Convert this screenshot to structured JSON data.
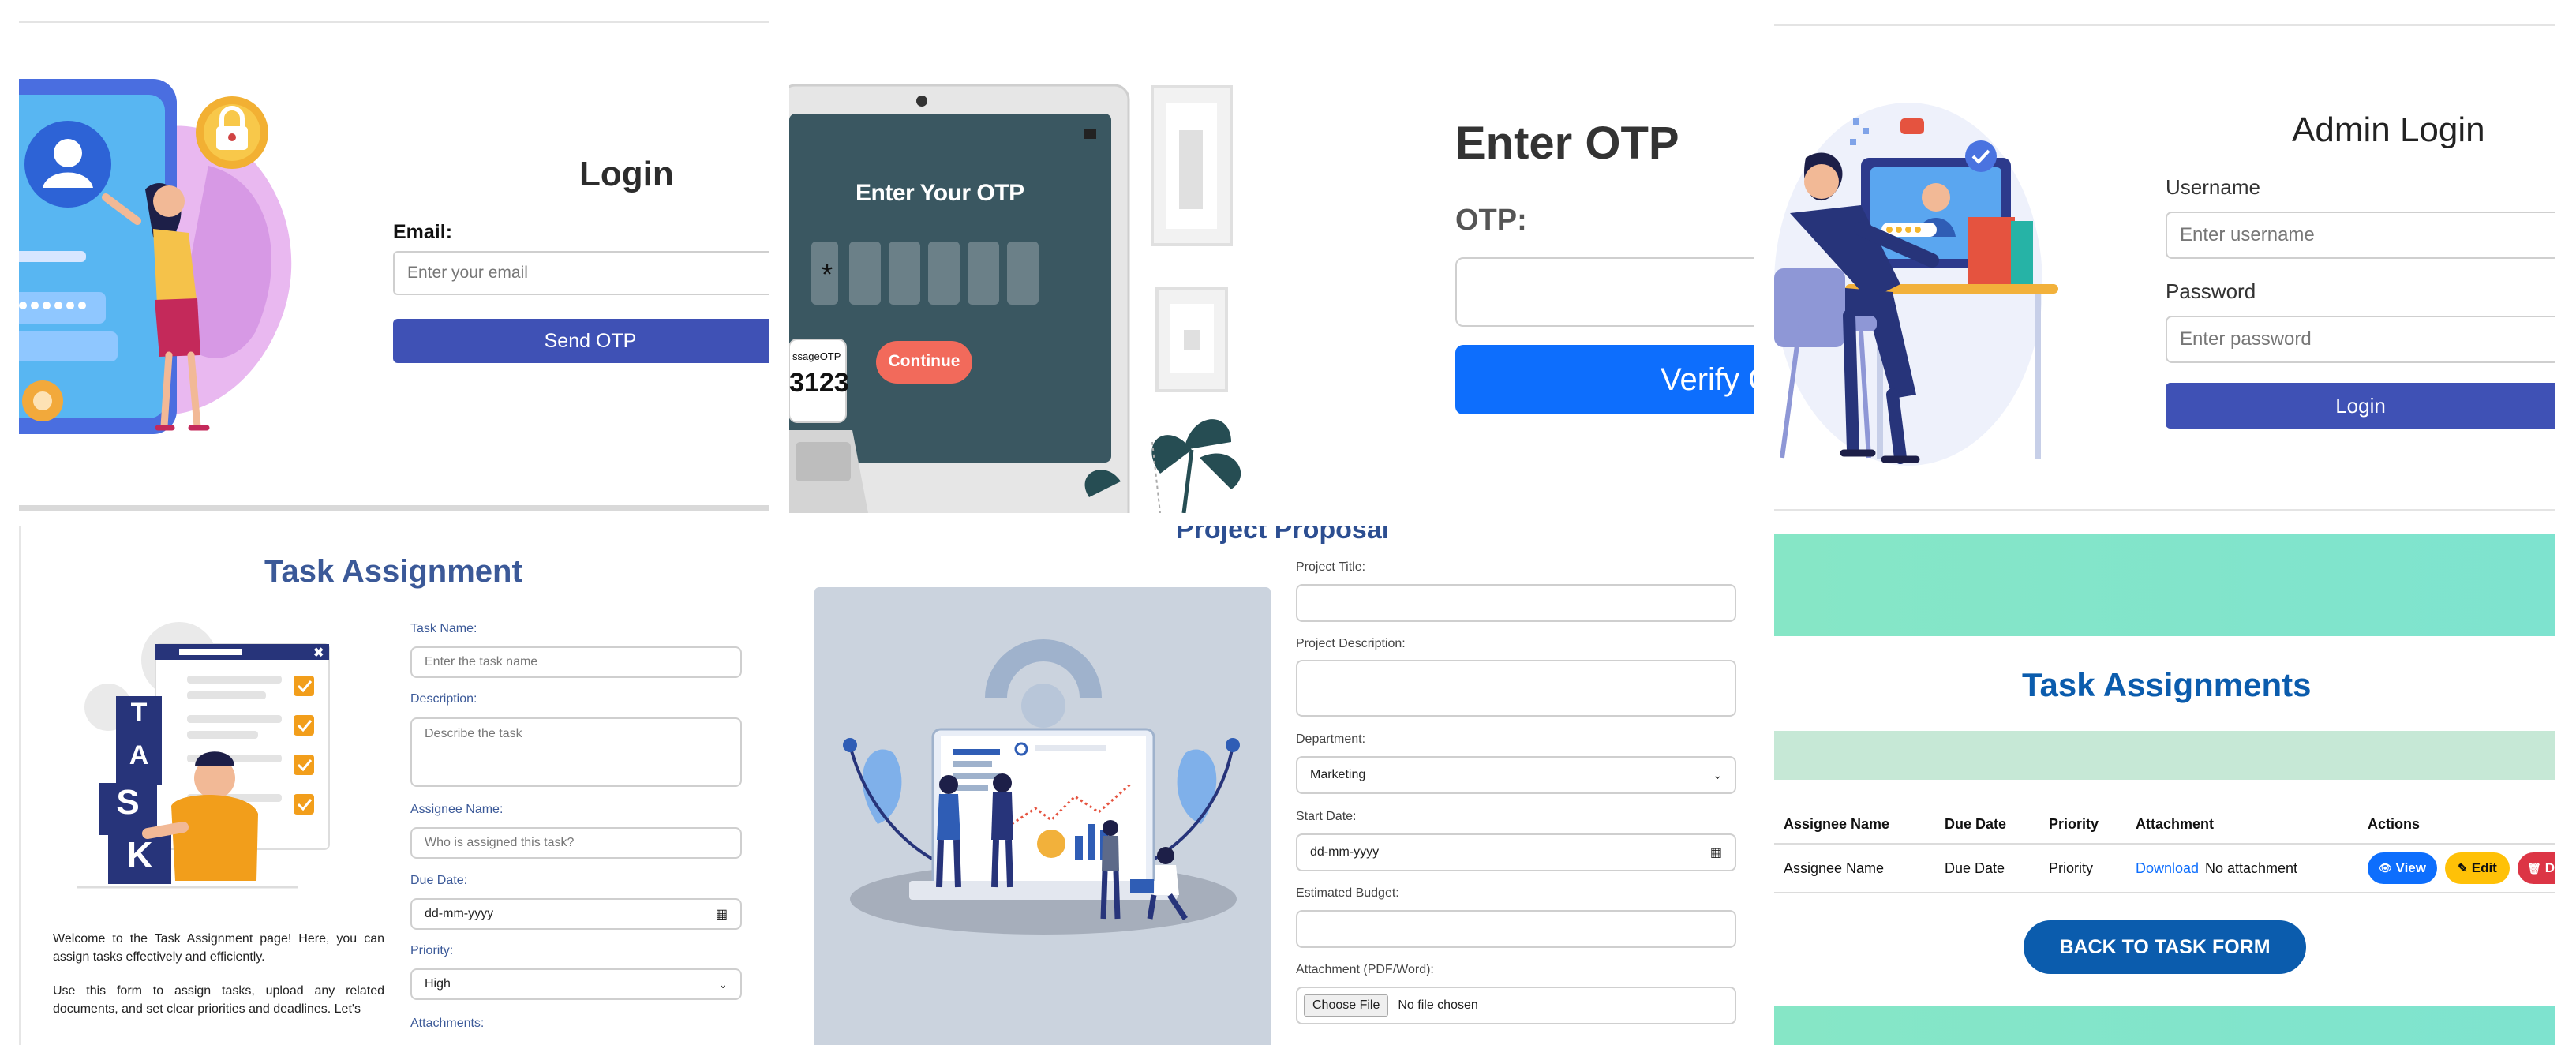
{
  "login_email": {
    "title": "Login",
    "email_label": "Email:",
    "email_placeholder": "Enter your email",
    "send_button": "Send OTP"
  },
  "otp_illustration": {
    "screen_heading": "Enter Your OTP",
    "continue_label": "Continue",
    "phone_label": "ssageOTP",
    "phone_code": "3123"
  },
  "verify_otp": {
    "title": "Enter OTP",
    "otp_label": "OTP:",
    "otp_value": "",
    "verify_button": "Verify O"
  },
  "admin_login": {
    "title": "Admin Login",
    "username_label": "Username",
    "username_placeholder": "Enter username",
    "password_label": "Password",
    "password_placeholder": "Enter password",
    "login_button": "Login"
  },
  "task_assignment": {
    "title": "Task Assignment",
    "illustration_letters": [
      "T",
      "A",
      "S",
      "K"
    ],
    "intro_1": "Welcome to the Task Assignment page! Here, you can assign tasks effectively and efficiently.",
    "intro_2": "Use this form to assign tasks, upload any related documents, and set clear priorities and deadlines. Let's",
    "fields": {
      "task_name_label": "Task Name:",
      "task_name_placeholder": "Enter the task name",
      "description_label": "Description:",
      "description_placeholder": "Describe the task",
      "assignee_label": "Assignee Name:",
      "assignee_placeholder": "Who is assigned this task?",
      "due_date_label": "Due Date:",
      "due_date_value": "dd-mm-yyyy",
      "priority_label": "Priority:",
      "priority_value": "High",
      "attachments_label": "Attachments:"
    }
  },
  "project_proposal": {
    "title": "Project Proposal",
    "project_title_label": "Project Title:",
    "project_description_label": "Project Description:",
    "department_label": "Department:",
    "department_value": "Marketing",
    "start_date_label": "Start Date:",
    "start_date_value": "dd-mm-yyyy",
    "budget_label": "Estimated Budget:",
    "attachment_label": "Attachment (PDF/Word):",
    "choose_file": "Choose File",
    "no_file": "No file chosen"
  },
  "task_assignments_table": {
    "title": "Task Assignments",
    "columns": [
      "Assignee Name",
      "Due Date",
      "Priority",
      "Attachment",
      "Actions"
    ],
    "row": {
      "assignee": "Assignee Name",
      "due_date": "Due Date",
      "priority": "Priority",
      "download": "Download",
      "no_attachment": "No attachment",
      "view": "View",
      "edit": "Edit",
      "delete": "D"
    },
    "back_button": "BACK TO TASK FORM"
  },
  "colors": {
    "indigo": "#3f51b5",
    "blue": "#0d6efd",
    "navy_title": "#3b5998",
    "proposal_title": "#2c4e91",
    "table_title": "#0b5cad",
    "teal_band": "#86e6c6",
    "yellow": "#ffc107",
    "red": "#dc3545",
    "otp_screen": "#3a5761"
  },
  "icons": [
    "padlock-icon",
    "user-icon",
    "eye-icon",
    "pencil-icon",
    "trash-icon",
    "calendar-icon",
    "chevron-down-icon",
    "check-icon"
  ]
}
